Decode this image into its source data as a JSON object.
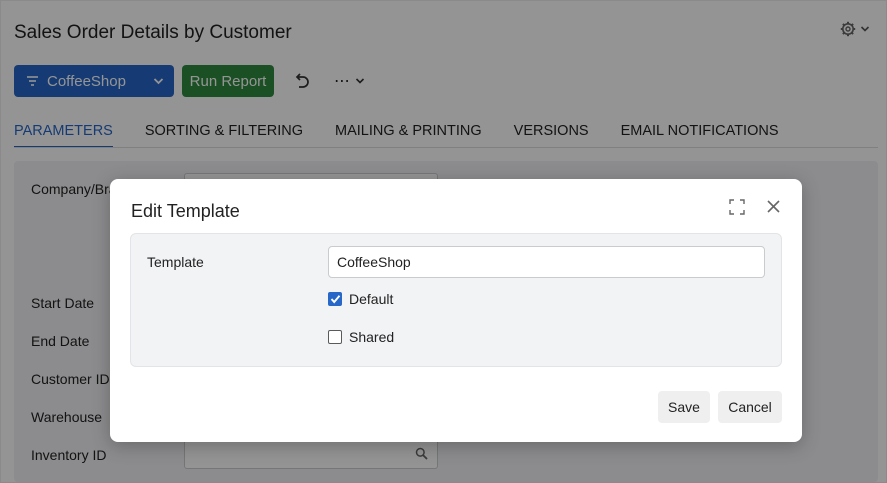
{
  "page": {
    "title": "Sales Order Details by Customer"
  },
  "toolbar": {
    "template_label": "CoffeeShop",
    "run_label": "Run Report",
    "more_label": "⋯"
  },
  "tabs": [
    {
      "label": "PARAMETERS",
      "active": true
    },
    {
      "label": "SORTING & FILTERING"
    },
    {
      "label": "MAILING & PRINTING"
    },
    {
      "label": "VERSIONS"
    },
    {
      "label": "EMAIL NOTIFICATIONS"
    }
  ],
  "form": {
    "company_label": "Company/Branch",
    "start_date_label": "Start Date",
    "end_date_label": "End Date",
    "customer_label": "Customer ID",
    "warehouse_label": "Warehouse",
    "inventory_label": "Inventory ID"
  },
  "modal": {
    "title": "Edit Template",
    "template_label": "Template",
    "template_value": "CoffeeShop",
    "default_label": "Default",
    "default_checked": true,
    "shared_label": "Shared",
    "shared_checked": false,
    "save_label": "Save",
    "cancel_label": "Cancel"
  },
  "colors": {
    "primary": "#2767c8",
    "success": "#2e8b3f"
  },
  "icons": [
    "gear-icon",
    "chevron-down-icon",
    "filter-icon",
    "undo-icon",
    "more-icon",
    "search-icon",
    "maximize-icon",
    "close-icon",
    "check-icon"
  ]
}
